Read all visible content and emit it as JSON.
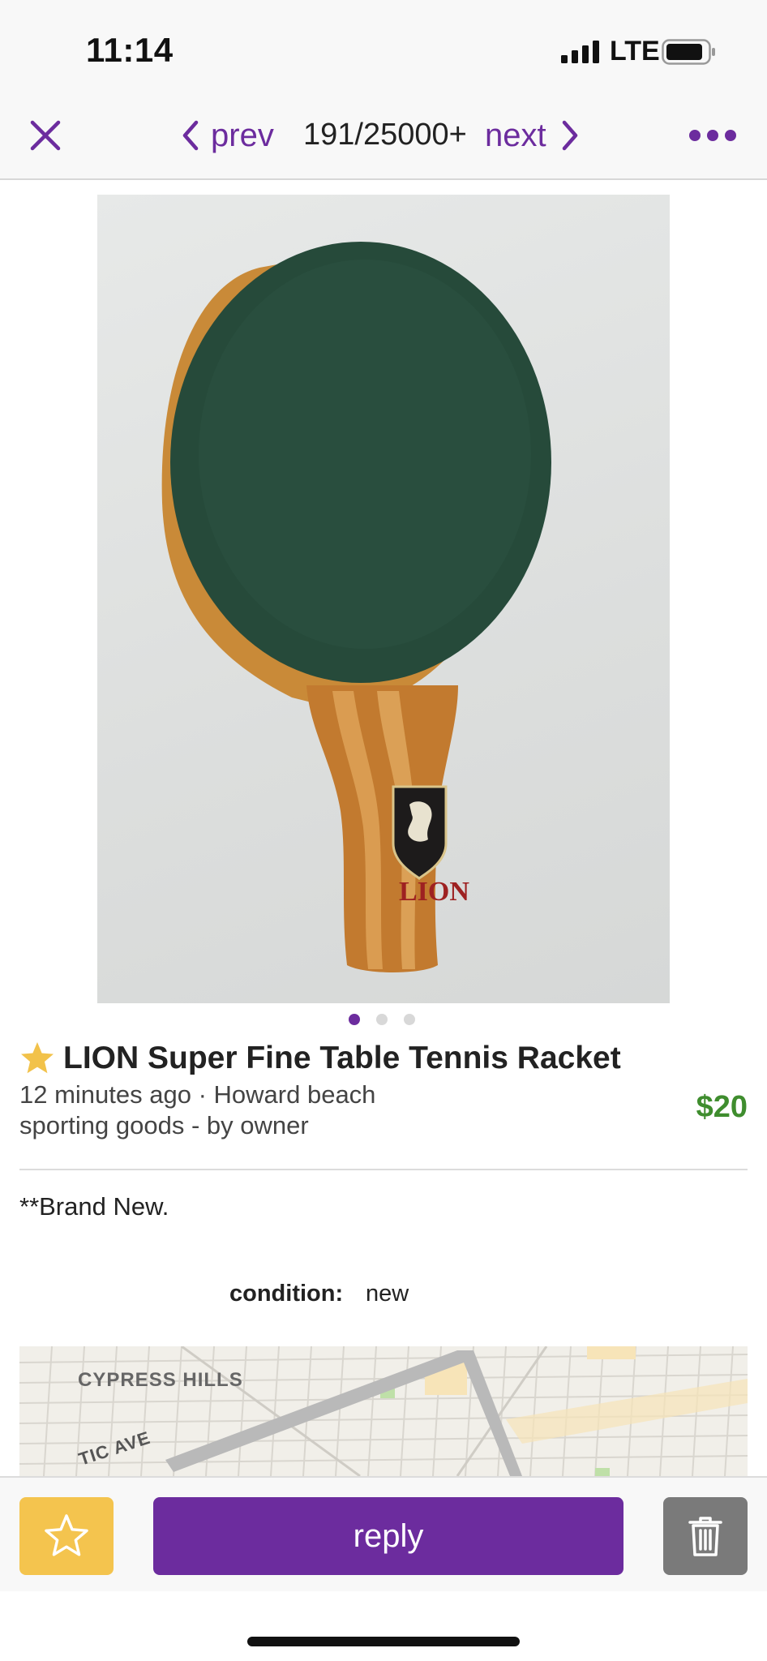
{
  "status_bar": {
    "time": "11:14",
    "network": "LTE"
  },
  "nav": {
    "prev_label": "prev",
    "counter": "191/25000+",
    "next_label": "next",
    "icons": [
      "close-icon",
      "chevron-left-icon",
      "chevron-right-icon",
      "more-icon"
    ],
    "accent_color": "#6c2c9e"
  },
  "gallery": {
    "image_count": 3,
    "active_index": 0,
    "photo_logo_text": "LION"
  },
  "listing": {
    "title": "LION Super Fine Table Tennis Racket",
    "posted": "12 minutes ago · Howard beach",
    "category": "sporting goods - by owner",
    "price": "$20",
    "price_color": "#3f8d2e",
    "description": "**Brand New.",
    "attributes": [
      {
        "label": "condition:",
        "value": "new"
      }
    ]
  },
  "map": {
    "labels": [
      "CYPRESS HILLS",
      "TIC AVE"
    ]
  },
  "actions": {
    "reply_label": "reply",
    "favorite_color": "#f4c44e",
    "reply_color": "#6c2c9e",
    "delete_color": "#7a7a7a"
  }
}
